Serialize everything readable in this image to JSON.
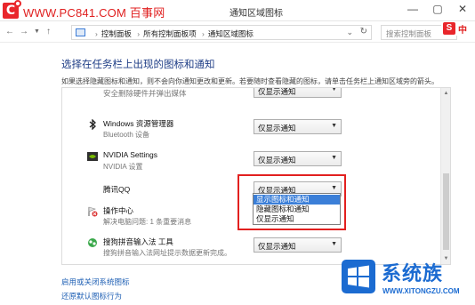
{
  "site": {
    "name": "WWW.PC841.COM 百事网"
  },
  "window": {
    "title": "通知区域图标",
    "controls": [
      "—",
      "▢",
      "✕"
    ]
  },
  "address": {
    "crumbs": [
      "控制面板",
      "所有控制面板项",
      "通知区域图标"
    ],
    "search_placeholder": "搜索控制面板"
  },
  "ime": {
    "badge": "S",
    "lang": "中"
  },
  "content": {
    "heading": "选择在任务栏上出现的图标和通知",
    "description": "如果选择隐藏图标和通知，则不会向你通知更改和更新。若要随时查看隐藏的图标，请单击任务栏上通知区域旁的箭头。",
    "rows": [
      {
        "name": "安全删除硬件并弹出媒体",
        "sub": "",
        "value": "仅显示通知",
        "icon": "usb-icon"
      },
      {
        "name": "Windows 资源管理器",
        "sub": "Bluetooth 设备",
        "value": "仅显示通知",
        "icon": "bluetooth-icon"
      },
      {
        "name": "NVIDIA Settings",
        "sub": "NVIDIA 设置",
        "value": "仅显示通知",
        "icon": "nvidia-icon"
      },
      {
        "name": "腾讯QQ",
        "sub": "",
        "value": "仅显示通知",
        "icon": "qq-icon"
      },
      {
        "name": "操作中心",
        "sub": "解决电脑问题: 1 条重要消息",
        "value": "",
        "icon": "flag-icon"
      },
      {
        "name": "搜狗拼音输入法 工具",
        "sub": "搜狗拼音输入法网址提示数据更新完成。",
        "value": "仅显示通知",
        "icon": "sogou-tool-icon"
      }
    ],
    "dropdown_options": [
      "显示图标和通知",
      "隐藏图标和通知",
      "仅显示通知"
    ],
    "dropdown_highlighted": "显示图标和通知",
    "links": [
      "启用或关闭系统图标",
      "还原默认图标行为"
    ]
  },
  "watermark": {
    "brand": "系统族",
    "url": "WWW.XITONGZU.COM"
  },
  "colors": {
    "accent": "#1e3d86",
    "link": "#1e5fb4",
    "highlight": "#3b7fd8",
    "callout": "#e2201f"
  }
}
